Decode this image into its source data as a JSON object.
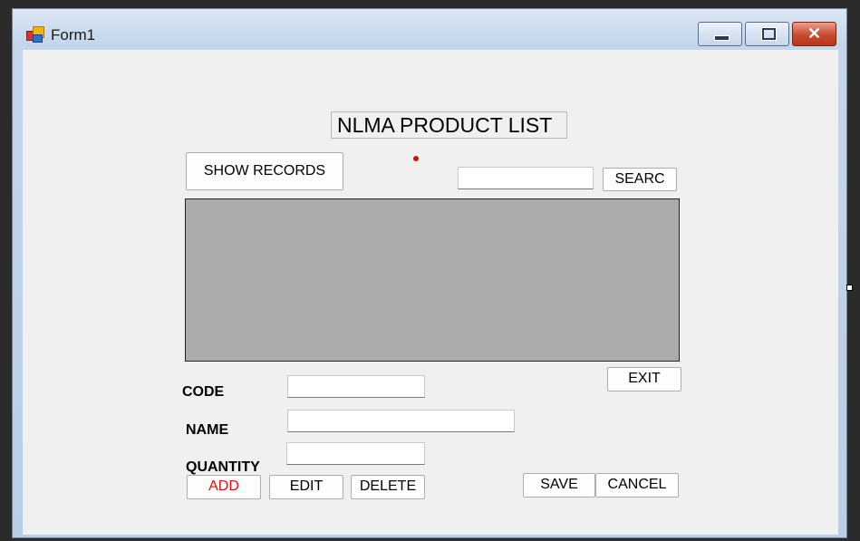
{
  "window": {
    "title": "Form1",
    "minimize_glyph": "",
    "maximize_glyph": "",
    "close_glyph": "✕"
  },
  "form": {
    "heading": "NLMA PRODUCT LIST",
    "show_records_label": "SHOW RECORDS",
    "search_input_value": "",
    "search_button_label": "SEARC",
    "exit_button_label": "EXIT",
    "code_label": "CODE",
    "code_value": "",
    "name_label": "NAME",
    "name_value": "",
    "quantity_label": "QUANTITY",
    "quantity_value": "",
    "add_button_label": "ADD",
    "edit_button_label": "EDIT",
    "delete_button_label": "DELETE",
    "save_button_label": "SAVE",
    "cancel_button_label": "CANCEL"
  },
  "colors": {
    "grid_background": "#ababab",
    "add_text": "#e81010",
    "close_button": "#c64a2e"
  }
}
